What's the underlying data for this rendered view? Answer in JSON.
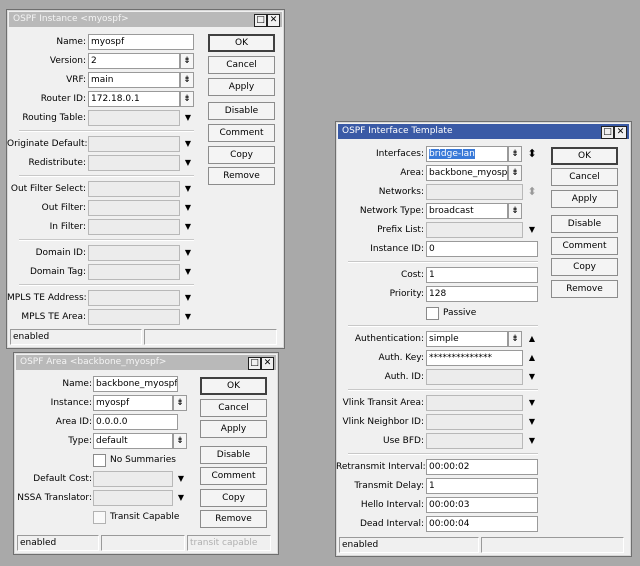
{
  "windows": [
    {
      "id": "ospf-instance",
      "title": "OSPF Instance <myospf>",
      "active": false,
      "groups": [
        [
          {
            "label": "Name:",
            "type": "text",
            "value": "myospf"
          },
          {
            "label": "Version:",
            "type": "select",
            "value": "2"
          },
          {
            "label": "VRF:",
            "type": "select",
            "value": "main"
          },
          {
            "label": "Router ID:",
            "type": "select",
            "value": "172.18.0.1"
          },
          {
            "label": "Routing Table:",
            "type": "dropdown",
            "value": ""
          }
        ],
        [
          {
            "label": "Originate Default:",
            "type": "dropdown",
            "value": ""
          },
          {
            "label": "Redistribute:",
            "type": "dropdown",
            "value": ""
          }
        ],
        [
          {
            "label": "Out Filter Select:",
            "type": "dropdown",
            "value": ""
          },
          {
            "label": "Out Filter:",
            "type": "dropdown",
            "value": ""
          },
          {
            "label": "In Filter:",
            "type": "dropdown",
            "value": ""
          }
        ],
        [
          {
            "label": "Domain ID:",
            "type": "dropdown",
            "value": ""
          },
          {
            "label": "Domain Tag:",
            "type": "dropdown",
            "value": ""
          }
        ],
        [
          {
            "label": "MPLS TE Address:",
            "type": "dropdown",
            "value": ""
          },
          {
            "label": "MPLS TE Area:",
            "type": "dropdown",
            "value": ""
          }
        ]
      ],
      "buttons": [
        "OK",
        "Cancel",
        "Apply",
        "Disable",
        "Comment",
        "Copy",
        "Remove"
      ],
      "status": [
        "enabled",
        ""
      ]
    },
    {
      "id": "ospf-area",
      "title": "OSPF Area <backbone_myospf>",
      "active": false,
      "groups": [
        [
          {
            "label": "Name:",
            "type": "text",
            "value": "backbone_myospf"
          },
          {
            "label": "Instance:",
            "type": "select",
            "value": "myospf"
          },
          {
            "label": "Area ID:",
            "type": "text",
            "value": "0.0.0.0"
          },
          {
            "label": "Type:",
            "type": "select",
            "value": "default"
          },
          {
            "label": "No Summaries",
            "type": "checkbox",
            "checked": false
          },
          {
            "label": "Default Cost:",
            "type": "dropdown",
            "value": ""
          },
          {
            "label": "NSSA Translator:",
            "type": "dropdown",
            "value": ""
          },
          {
            "label": "Transit Capable",
            "type": "checkbox",
            "checked": false,
            "disabled": true
          }
        ]
      ],
      "buttons": [
        "OK",
        "Cancel",
        "Apply",
        "Disable",
        "Comment",
        "Copy",
        "Remove"
      ],
      "status": [
        "enabled",
        "",
        "transit capable"
      ]
    },
    {
      "id": "ospf-interface-template",
      "title": "OSPF Interface Template",
      "active": true,
      "groups": [
        [
          {
            "label": "Interfaces:",
            "type": "select",
            "value": "bridge-lan",
            "highlight": true,
            "extra": "updown"
          },
          {
            "label": "Area:",
            "type": "select",
            "value": "backbone_myospf"
          },
          {
            "label": "Networks:",
            "type": "dropdown",
            "value": "",
            "extra": "updown-dis"
          },
          {
            "label": "Network Type:",
            "type": "select",
            "value": "broadcast"
          },
          {
            "label": "Prefix List:",
            "type": "dropdown",
            "value": ""
          },
          {
            "label": "Instance ID:",
            "type": "text",
            "value": "0"
          }
        ],
        [
          {
            "label": "Cost:",
            "type": "text",
            "value": "1"
          },
          {
            "label": "Priority:",
            "type": "text",
            "value": "128"
          },
          {
            "label": "Passive",
            "type": "checkbox",
            "checked": false
          }
        ],
        [
          {
            "label": "Authentication:",
            "type": "select",
            "value": "simple",
            "extra": "up"
          },
          {
            "label": "Auth. Key:",
            "type": "dropdown",
            "value": "**************",
            "filled": true,
            "extra": "up"
          },
          {
            "label": "Auth. ID:",
            "type": "dropdown",
            "value": ""
          }
        ],
        [
          {
            "label": "Vlink Transit Area:",
            "type": "dropdown",
            "value": ""
          },
          {
            "label": "Vlink Neighbor ID:",
            "type": "dropdown",
            "value": ""
          },
          {
            "label": "Use BFD:",
            "type": "dropdown",
            "value": ""
          }
        ],
        [
          {
            "label": "Retransmit Interval:",
            "type": "text",
            "value": "00:00:02"
          },
          {
            "label": "Transmit Delay:",
            "type": "text",
            "value": "1"
          },
          {
            "label": "Hello Interval:",
            "type": "text",
            "value": "00:00:03"
          },
          {
            "label": "Dead Interval:",
            "type": "text",
            "value": "00:00:04"
          }
        ]
      ],
      "buttons": [
        "OK",
        "Cancel",
        "Apply",
        "Disable",
        "Comment",
        "Copy",
        "Remove"
      ],
      "status": [
        "enabled",
        ""
      ]
    }
  ],
  "icons": {
    "maximize": "□",
    "close": "✕",
    "select": "▾",
    "dropdown": "▼",
    "updown": "⬍",
    "up": "▲"
  }
}
